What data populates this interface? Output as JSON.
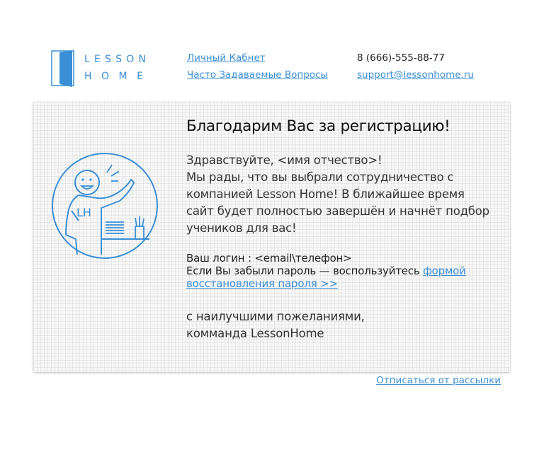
{
  "header": {
    "logo_line1": "LESSON",
    "logo_line2": "HOME",
    "link_cabinet": "Личный Кабнет",
    "link_faq": "Часто Задаваемые Вопросы ",
    "phone": "8 (666)-555-88-77",
    "email": "support@lessonhome.ru"
  },
  "card": {
    "title": "Благодарим Вас за регистрацию!",
    "greeting": "Здравствуйте, <имя отчество>!",
    "body": "Мы рады, что вы выбрали сотрудничество с компанией Lesson Home! В ближайшее время сайт будет полностью завершён и начнёт подбор учеников для вас!",
    "login_line": "Ваш логин : <email\\телефон>",
    "forgot_text": "Если Вы забыли пароль — воспользуйтесь ",
    "forgot_link": "формой восстановления пароля >>",
    "closing1": "с наилучшими пожеланиями,",
    "closing2": "комманда LessonHome",
    "illustration_text": "LH"
  },
  "footer": {
    "unsubscribe": "Отписаться от рассылки"
  },
  "colors": {
    "accent": "#3a8fd6",
    "card_bg": "#f7f7f7",
    "text": "#222222"
  }
}
